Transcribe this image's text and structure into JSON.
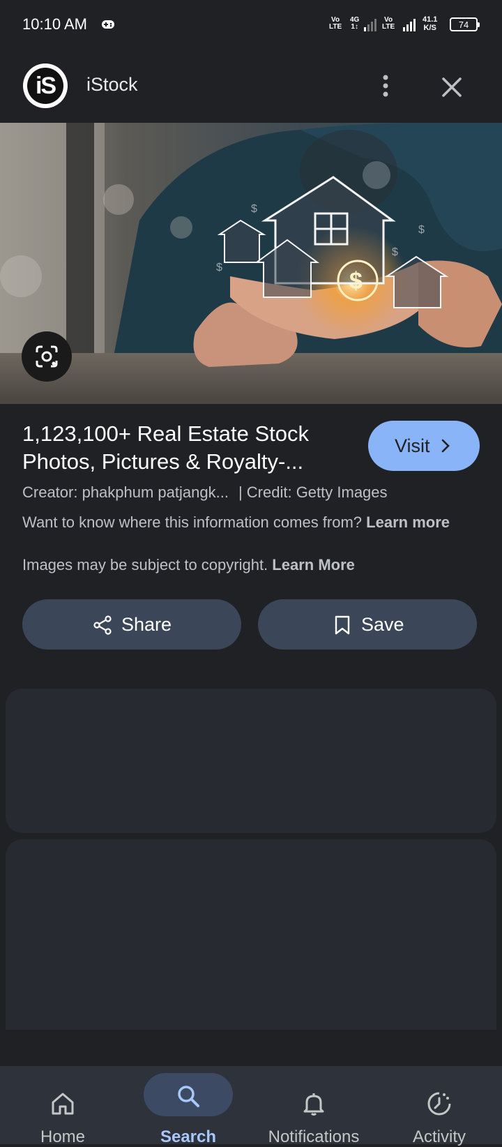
{
  "status_bar": {
    "time": "10:10 AM",
    "net1_top": "Vo",
    "net1_bottom": "LTE",
    "net2_top": "4G",
    "net2_bottom": "1↕",
    "net3_top": "Vo",
    "net3_bottom": "LTE",
    "speed_value": "41.1",
    "speed_unit": "K/S",
    "battery": "74"
  },
  "header": {
    "logo_text": "iS",
    "site_name": "iStock"
  },
  "result": {
    "title_line1": "1,123,100+ Real Estate Stock",
    "title_line2": "Photos, Pictures & Royalty-...",
    "visit_label": "Visit",
    "creator": "Creator: phakphum patjangk...",
    "credit": "| Credit: Getty Images",
    "info_text": "Want to know where this information comes from?",
    "info_link": "Learn more",
    "copyright_text": "Images may be subject to copyright.",
    "copyright_link": "Learn More"
  },
  "actions": {
    "share_label": "Share",
    "save_label": "Save"
  },
  "bottom_nav": {
    "items": [
      {
        "label": "Home",
        "icon": "home-icon"
      },
      {
        "label": "Search",
        "icon": "search-icon",
        "active": true
      },
      {
        "label": "Notifications",
        "icon": "bell-icon"
      },
      {
        "label": "Activity",
        "icon": "activity-icon"
      }
    ]
  },
  "colors": {
    "background": "#202124",
    "accent": "#8ab4f8",
    "button": "#3c4659",
    "nav_background": "#2e323b"
  }
}
